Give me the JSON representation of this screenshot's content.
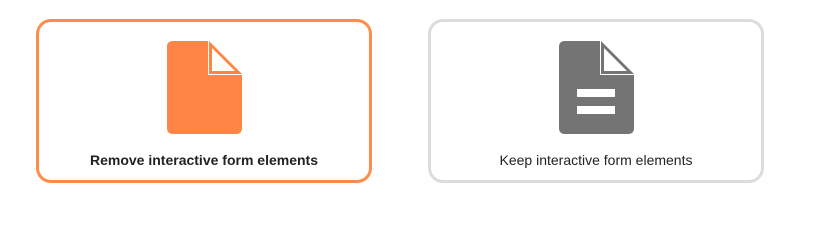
{
  "options": [
    {
      "label": "Remove interactive form elements",
      "icon": "file-icon",
      "selected": true,
      "color": "#ff8547"
    },
    {
      "label": "Keep interactive form elements",
      "icon": "file-text-icon",
      "selected": false,
      "color": "#747474"
    }
  ],
  "colors": {
    "selected_border": "#ff8c4c",
    "unselected_border": "#dcdcdc",
    "label_text": "#222222"
  }
}
